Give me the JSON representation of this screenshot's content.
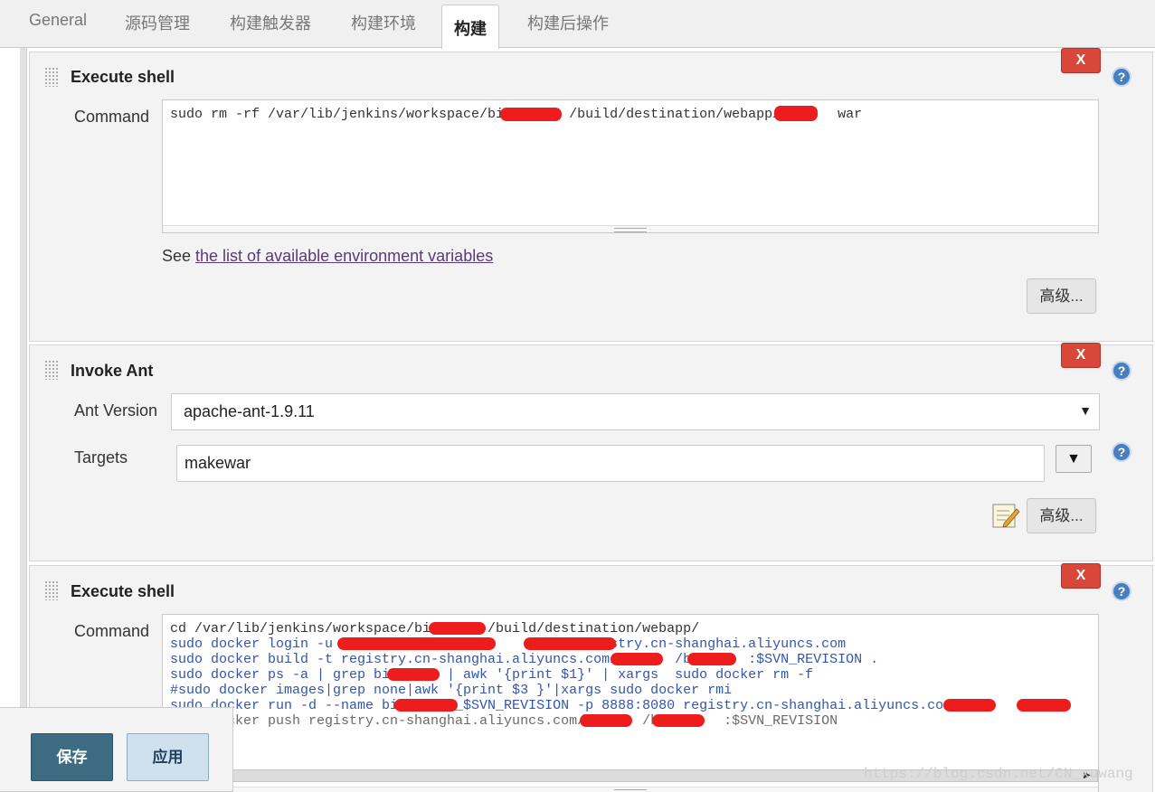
{
  "tabs": [
    {
      "label": "General"
    },
    {
      "label": "源码管理"
    },
    {
      "label": "构建触发器"
    },
    {
      "label": "构建环境"
    },
    {
      "label": "构建",
      "active": true
    },
    {
      "label": "构建后操作"
    }
  ],
  "step1": {
    "title": "Execute shell",
    "delete_label": "X",
    "help_label": "?",
    "command_label": "Command",
    "command_lines": [
      "sudo rm -rf /var/lib/jenkins/workspace/bi        /build/destination/webapp/B      war"
    ],
    "env_prefix": "See ",
    "env_link": "the list of available environment variables",
    "advanced_label": "高级..."
  },
  "step2": {
    "title": "Invoke Ant",
    "delete_label": "X",
    "help_label": "?",
    "ant_version_label": "Ant Version",
    "ant_version_value": "apache-ant-1.9.11",
    "targets_label": "Targets",
    "targets_value": "makewar",
    "expand_label": "▼",
    "advanced_label": "高级..."
  },
  "step3": {
    "title": "Execute shell",
    "delete_label": "X",
    "help_label": "?",
    "command_label": "Command",
    "lines": {
      "l1": "cd /var/lib/jenkins/workspace/bi       /build/destination/webapp/",
      "l2": "sudo docker login -u                  -p          registry.cn-shanghai.aliyuncs.com",
      "l3": "sudo docker build -t registry.cn-shanghai.aliyuncs.com/       /bi      :$SVN_REVISION .",
      "l4": "sudo docker ps -a | grep bi       | awk '{print $1}' | xargs  sudo docker rm -f",
      "l5": "#sudo docker images|grep none|awk '{print $3 }'|xargs sudo docker rmi",
      "l6": "sudo docker run -d --name bi       _$SVN_REVISION -p 8888:8080 registry.cn-shanghai.aliyuncs.com/       /bi       :$SV",
      "l7": "sudo docker push registry.cn-shanghai.aliyuncs.com/       /bi       :$SVN_REVISION"
    }
  },
  "bottom": {
    "save_label": "保存",
    "apply_label": "应用"
  },
  "watermark": "https://blog.csdn.net/CN_xuwang",
  "colors": {
    "delete_red": "#d9473a",
    "save_blue": "#3d6b82",
    "help_blue": "#4a7fbf"
  }
}
